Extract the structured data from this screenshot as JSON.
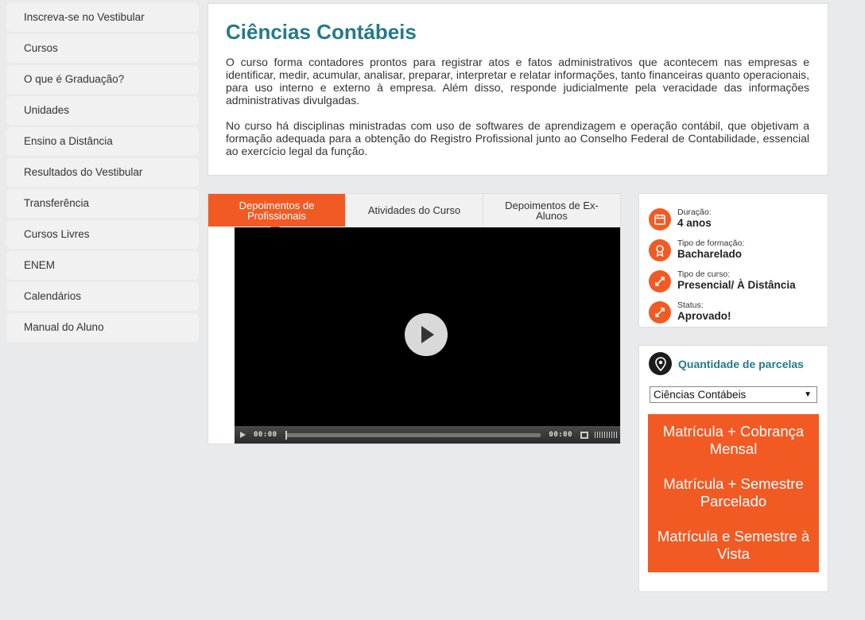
{
  "sidebar": {
    "items": [
      {
        "label": "Inscreva-se no Vestibular"
      },
      {
        "label": "Cursos"
      },
      {
        "label": "O que é Graduação?"
      },
      {
        "label": "Unidades"
      },
      {
        "label": "Ensino a Distância"
      },
      {
        "label": "Resultados do Vestibular"
      },
      {
        "label": "Transferência"
      },
      {
        "label": "Cursos Livres"
      },
      {
        "label": "ENEM"
      },
      {
        "label": "Calendários"
      },
      {
        "label": "Manual do Aluno"
      }
    ]
  },
  "description": {
    "title": "Ciências Contábeis",
    "paragraph1": "O curso forma contadores prontos para registrar atos e fatos administrativos que acontecem nas empresas e identificar, medir, acumular, analisar, preparar, interpretar e relatar informações, tanto financeiras quanto operacionais, para uso interno e externo à empresa. Além disso, responde judicialmente pela veracidade das informações administrativas divulgadas.",
    "paragraph2": "No curso há disciplinas ministradas com uso de softwares de aprendizagem e operação contábil, que objetivam a formação adequada para a obtenção do Registro Profissional junto ao Conselho Federal de Contabilidade, essencial ao exercício legal da função."
  },
  "tabs": [
    {
      "label": "Depoimentos de Profissionais",
      "active": true
    },
    {
      "label": "Atividades do Curso",
      "active": false
    },
    {
      "label": "Depoimentos de Ex-Alunos",
      "active": false
    }
  ],
  "video": {
    "current_time": "00:00",
    "duration": "00:00"
  },
  "info": {
    "accent_color": "#f25a24",
    "items": [
      {
        "label": "Duração:",
        "value": "4 anos",
        "icon": "calendar-icon"
      },
      {
        "label": "Tipo de formação:",
        "value": "Bacharelado",
        "icon": "award-icon"
      },
      {
        "label": "Tipo de curso:",
        "value": "Presencial/ À Distância",
        "icon": "arrows-icon"
      },
      {
        "label": "Status:",
        "value": "Aprovado!",
        "icon": "arrows-icon"
      }
    ]
  },
  "parcelas": {
    "title": "Quantidade de parcelas",
    "select_value": "Ciências Contábeis",
    "options": [
      "Matrícula + Cobrança Mensal",
      "Matrícula + Semestre Parcelado",
      "Matrícula e Semestre à Vista"
    ]
  }
}
